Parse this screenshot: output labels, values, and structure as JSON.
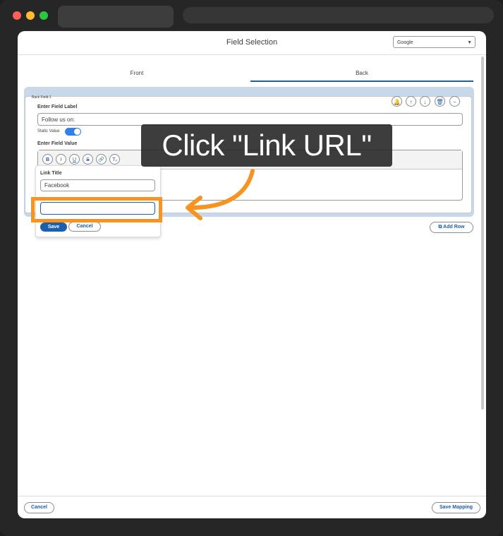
{
  "window": {
    "colors": {
      "close": "#ff5f57",
      "minimize": "#febc2e",
      "zoom": "#28c840"
    }
  },
  "modal": {
    "title": "Field Selection",
    "provider_select": {
      "value": "Google"
    },
    "tabs": [
      {
        "label": "Front",
        "active": false
      },
      {
        "label": "Back",
        "active": true
      }
    ]
  },
  "field_card": {
    "title": "Back Field-1",
    "action_icons": [
      "bell-icon",
      "arrow-up-icon",
      "arrow-down-icon",
      "trash-icon",
      "minus-icon"
    ],
    "label_heading": "Enter Field Label",
    "label_value": "Follow us on:",
    "static_value_label": "Static Value",
    "static_value_on": true,
    "value_heading": "Enter Field Value",
    "toolbar": [
      {
        "name": "bold-icon",
        "glyph": "B"
      },
      {
        "name": "italic-icon",
        "glyph": "I"
      },
      {
        "name": "underline-icon",
        "glyph": "U"
      },
      {
        "name": "strikethrough-icon",
        "glyph": "S"
      },
      {
        "name": "link-icon",
        "glyph": "🔗"
      },
      {
        "name": "clear-format-icon",
        "glyph": "Tₓ"
      }
    ]
  },
  "link_popover": {
    "title_label": "Link Title",
    "title_value": "Facebook",
    "url_value": "",
    "save_label": "Save",
    "cancel_label": "Cancel"
  },
  "add_row_label": "Add Row",
  "footer": {
    "cancel_label": "Cancel",
    "save_mapping_label": "Save Mapping"
  },
  "overlay": {
    "instruction": "Click \"Link URL\"",
    "accent_color": "#f7931e"
  },
  "colors": {
    "brand": "#1b5fad",
    "toggle": "#2f80ed",
    "card_bg": "#c7d8ea"
  }
}
